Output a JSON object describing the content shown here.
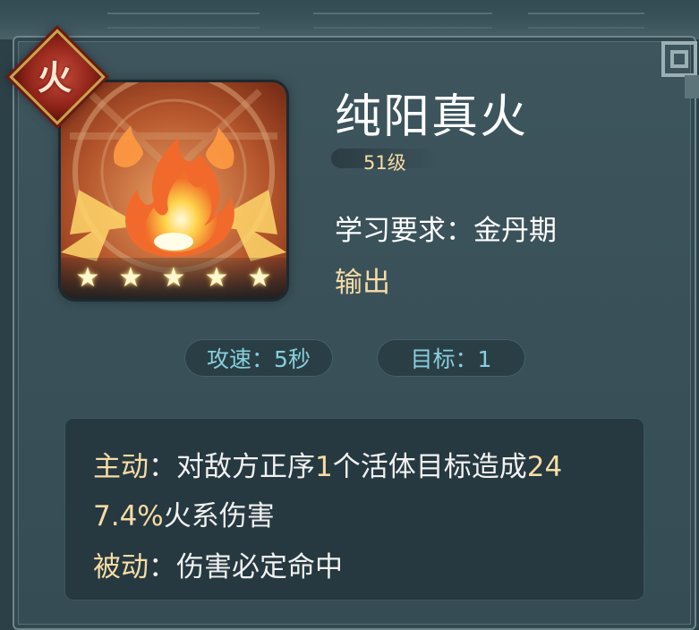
{
  "skill": {
    "element_char": "火",
    "name": "纯阳真火",
    "level": "51级",
    "requirement_label": "学习要求",
    "requirement_sep": "：",
    "requirement_value": "金丹期",
    "type": "输出",
    "stars": [
      "★",
      "★",
      "★",
      "★",
      "★"
    ]
  },
  "stats": {
    "speed": "攻速：5秒",
    "targets": "目标：1"
  },
  "description": {
    "active_label": "主动",
    "active_sep": "：",
    "active_text_1a": "对敌方正序",
    "active_num_1": "1",
    "active_text_1b": "个活体目标造成",
    "active_num_2": "24",
    "active_num_3": "7.4%",
    "active_text_2": "火系伤害",
    "passive_label": "被动",
    "passive_sep": "：",
    "passive_text": "伤害必定命中"
  },
  "colors": {
    "accent_gold": "#f6dca5",
    "stat_cyan": "#86d0dc",
    "badge_red": "#8e2318"
  },
  "icons": {
    "element_badge": "fire-element-badge-icon",
    "skill_art": "flame-skill-icon",
    "star": "star-icon"
  }
}
